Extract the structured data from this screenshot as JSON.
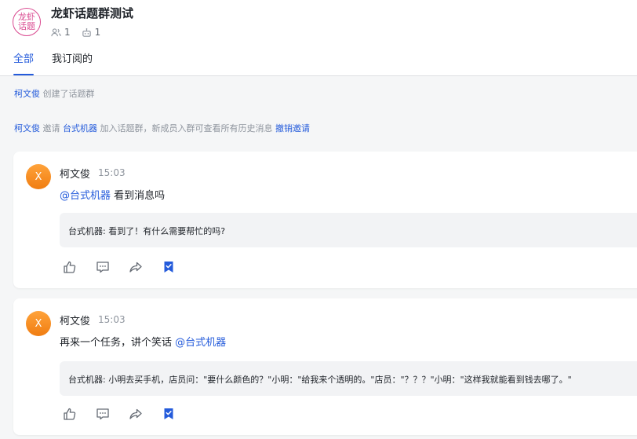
{
  "header": {
    "avatar_text_line1": "龙虾",
    "avatar_text_line2": "话题",
    "title": "龙虾话题群测试",
    "members_count": "1",
    "bots_count": "1",
    "member_icon": "members-icon",
    "bot_icon": "robot-icon"
  },
  "tabs": [
    {
      "label": "全部",
      "active": true
    },
    {
      "label": "我订阅的",
      "active": false
    }
  ],
  "system_messages": {
    "created": {
      "user": "柯文俊",
      "text": " 创建了话题群"
    },
    "invited": {
      "user": "柯文俊",
      "text1": " 邀请 ",
      "bot": "台式机器",
      "text2": " 加入话题群，新成员入群可查看所有历史消息 ",
      "revoke": "撤销邀请"
    }
  },
  "posts": [
    {
      "avatar": "X",
      "sender": "柯文俊",
      "time": "15:03",
      "mention": "@台式机器",
      "text": " 看到消息吗",
      "reply": "台式机器: 看到了！有什么需要帮忙的吗?"
    },
    {
      "avatar": "X",
      "sender": "柯文俊",
      "time": "15:03",
      "text": "再来一个任务，讲个笑话 ",
      "mention": "@台式机器",
      "reply": "台式机器: 小明去买手机，店员问：\"要什么颜色的？\"小明：\"给我来个透明的。\"店员：\"？？？\"小明：\"这样我就能看到钱去哪了。\""
    }
  ],
  "colors": {
    "accent": "#245bdb",
    "avatar_orange": "#f08a1c",
    "group_avatar_pink": "#d9488f",
    "feed_bg": "#f5f6f7"
  }
}
